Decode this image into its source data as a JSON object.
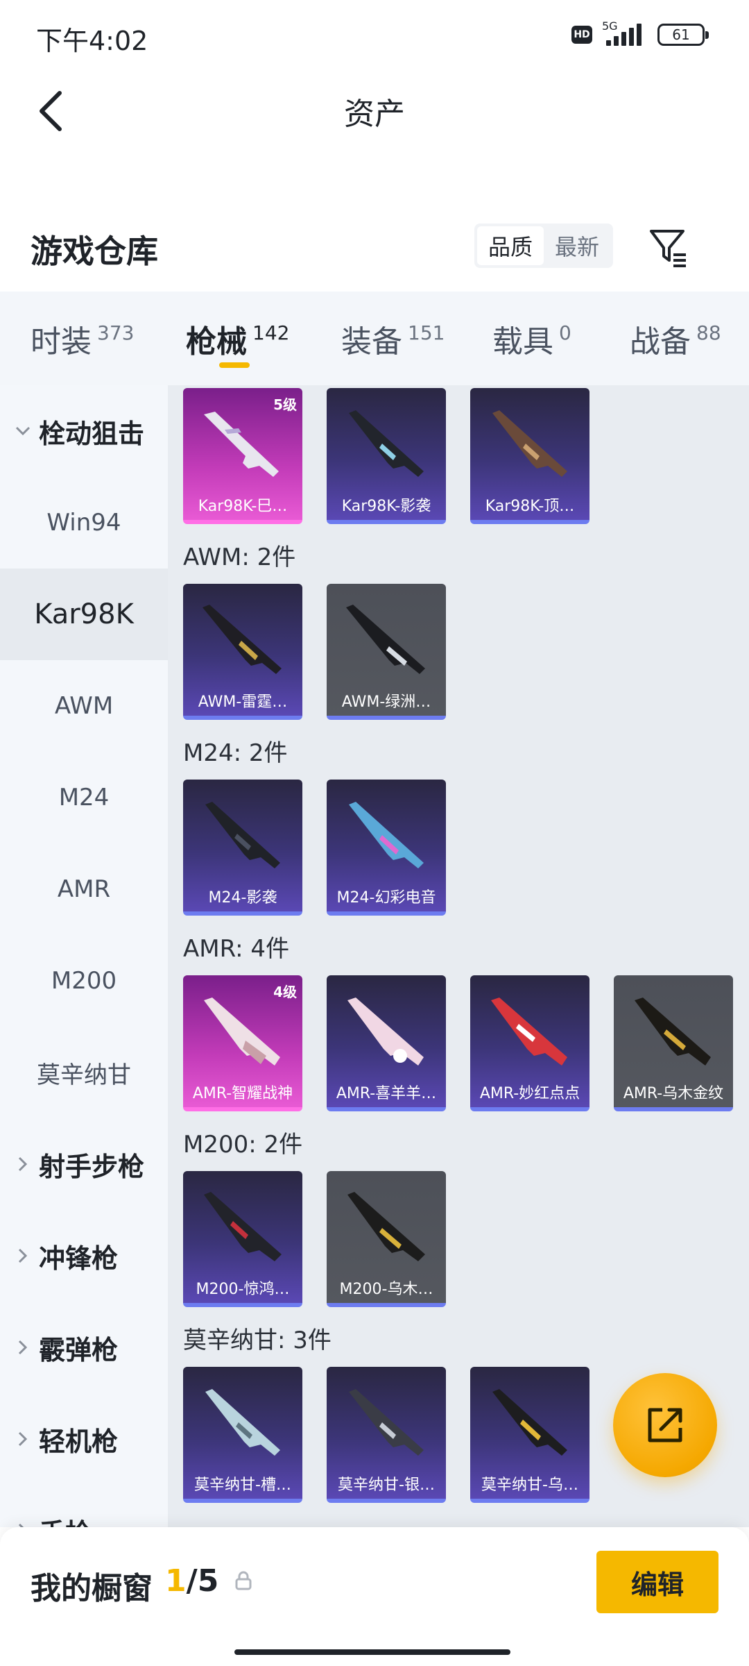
{
  "status_bar": {
    "time": "下午4:02",
    "hd": "HD",
    "network": "5G",
    "battery": "61"
  },
  "header": {
    "title": "资产"
  },
  "section": {
    "title": "游戏仓库",
    "sort_options": [
      "品质",
      "最新"
    ],
    "sort_selected": "品质"
  },
  "tabs": [
    {
      "label": "时装",
      "count": "373"
    },
    {
      "label": "枪械",
      "count": "142",
      "active": true
    },
    {
      "label": "装备",
      "count": "151"
    },
    {
      "label": "载具",
      "count": "0"
    },
    {
      "label": "战备",
      "count": "88"
    }
  ],
  "sidebar": {
    "category": "栓动狙击",
    "items": [
      "Win94",
      "Kar98K",
      "AWM",
      "M24",
      "AMR",
      "M200",
      "莫辛纳甘"
    ],
    "selected": "Kar98K",
    "collapsed_categories": [
      "射手步枪",
      "冲锋枪",
      "霰弹枪",
      "轻机枪",
      "手枪"
    ]
  },
  "groups": [
    {
      "label": "",
      "items": [
        {
          "name": "Kar98K-巳…",
          "level": "5级",
          "rarity": "pink"
        },
        {
          "name": "Kar98K-影袭",
          "rarity": "purple"
        },
        {
          "name": "Kar98K-顶…",
          "rarity": "purple"
        }
      ]
    },
    {
      "label": "AWM: 2件",
      "items": [
        {
          "name": "AWM-雷霆…",
          "rarity": "purple"
        },
        {
          "name": "AWM-绿洲…",
          "rarity": "gray"
        }
      ]
    },
    {
      "label": "M24: 2件",
      "items": [
        {
          "name": "M24-影袭",
          "rarity": "purple"
        },
        {
          "name": "M24-幻彩电音",
          "rarity": "purple"
        }
      ]
    },
    {
      "label": "AMR: 4件",
      "items": [
        {
          "name": "AMR-智耀战神",
          "level": "4级",
          "rarity": "pink"
        },
        {
          "name": "AMR-喜羊羊…",
          "rarity": "purple"
        },
        {
          "name": "AMR-妙红点点",
          "rarity": "purple"
        },
        {
          "name": "AMR-乌木金纹",
          "rarity": "gray"
        }
      ]
    },
    {
      "label": "M200: 2件",
      "items": [
        {
          "name": "M200-惊鸿…",
          "rarity": "purple"
        },
        {
          "name": "M200-乌木…",
          "rarity": "gray"
        }
      ]
    },
    {
      "label": "莫辛纳甘: 3件",
      "items": [
        {
          "name": "莫辛纳甘-槽…",
          "rarity": "purple"
        },
        {
          "name": "莫辛纳甘-银…",
          "rarity": "purple"
        },
        {
          "name": "莫辛纳甘-乌…",
          "rarity": "purple"
        }
      ]
    }
  ],
  "bottom_bar": {
    "title": "我的橱窗",
    "count_current": "1",
    "count_total": "/5",
    "edit_label": "编辑"
  },
  "icons": {
    "back": "back-arrow-icon",
    "filter": "filter-icon",
    "share": "share-external-icon",
    "lock": "lock-icon"
  },
  "colors": {
    "accent": "#f5b800",
    "rarity_purple": "#6d7cf0",
    "rarity_pink": "#ff6ee6"
  }
}
